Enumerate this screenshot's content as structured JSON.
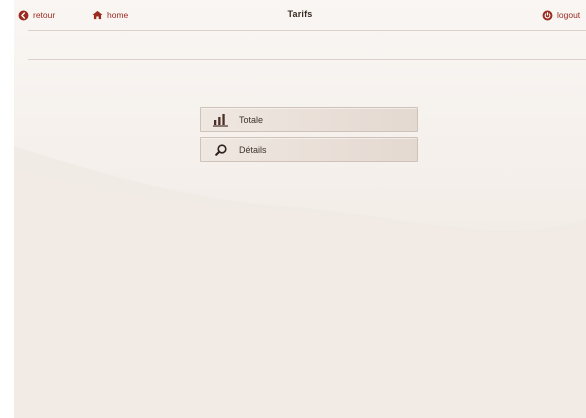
{
  "header": {
    "back_label": "retour",
    "home_label": "home",
    "title": "Tarifs",
    "logout_label": "logout"
  },
  "menu": {
    "items": [
      {
        "label": "Totale",
        "icon": "bar-chart-icon"
      },
      {
        "label": "Détails",
        "icon": "search-icon"
      }
    ]
  },
  "colors": {
    "accent": "#9b2a1f",
    "background": "#f1ebe6",
    "button": "#e8ded7"
  }
}
